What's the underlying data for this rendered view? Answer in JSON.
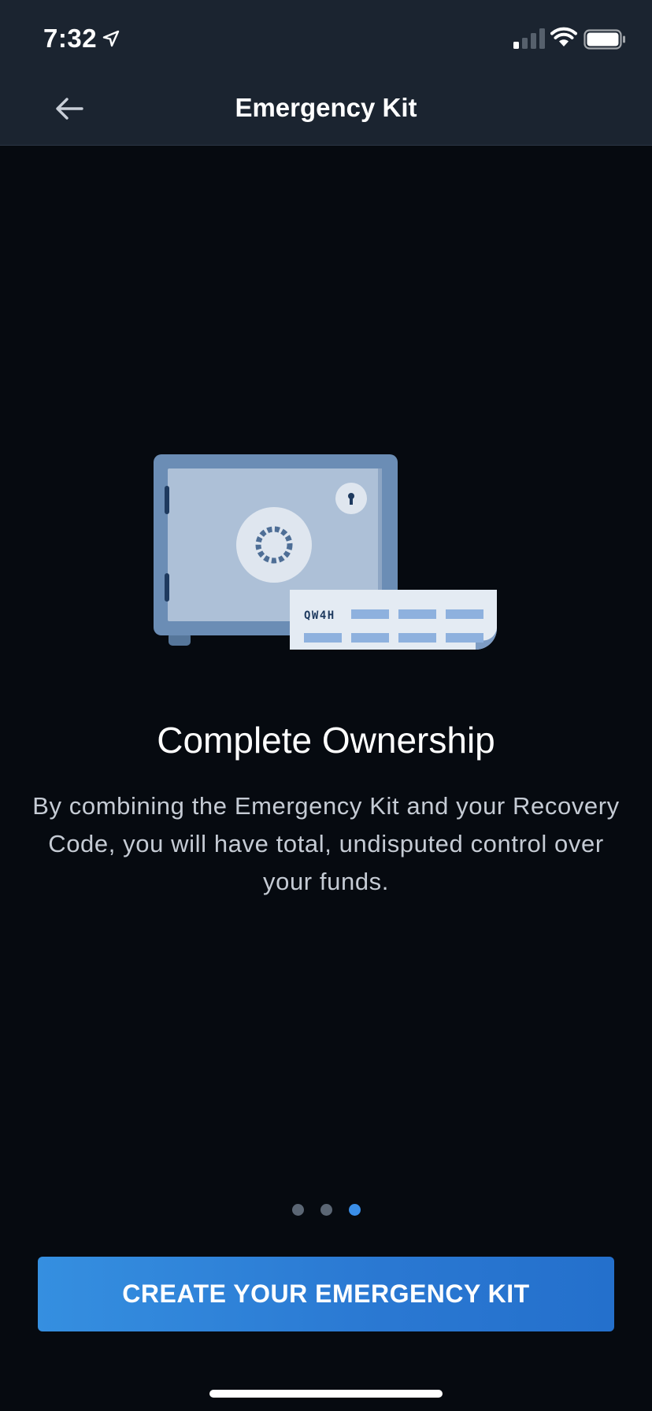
{
  "status_bar": {
    "time": "7:32",
    "icons": [
      "location-arrow-icon",
      "signal-icon",
      "wifi-icon",
      "battery-icon"
    ]
  },
  "header": {
    "title": "Emergency Kit",
    "back_icon": "arrow-left-icon"
  },
  "illustration": {
    "paper_code": "QW4H",
    "icons": [
      "safe-icon",
      "keyhole-icon",
      "dial-icon",
      "paper-icon"
    ]
  },
  "content": {
    "headline": "Complete Ownership",
    "body": "By combining the Emergency Kit and your Recovery Code, you will have total, undisputed control over your funds."
  },
  "pager": {
    "count": 3,
    "active_index": 2
  },
  "cta": {
    "label": "CREATE YOUR EMERGENCY KIT"
  },
  "colors": {
    "background": "#060a10",
    "header": "#1b2430",
    "accent": "#3a8ee8",
    "button": "#2f84d8"
  }
}
